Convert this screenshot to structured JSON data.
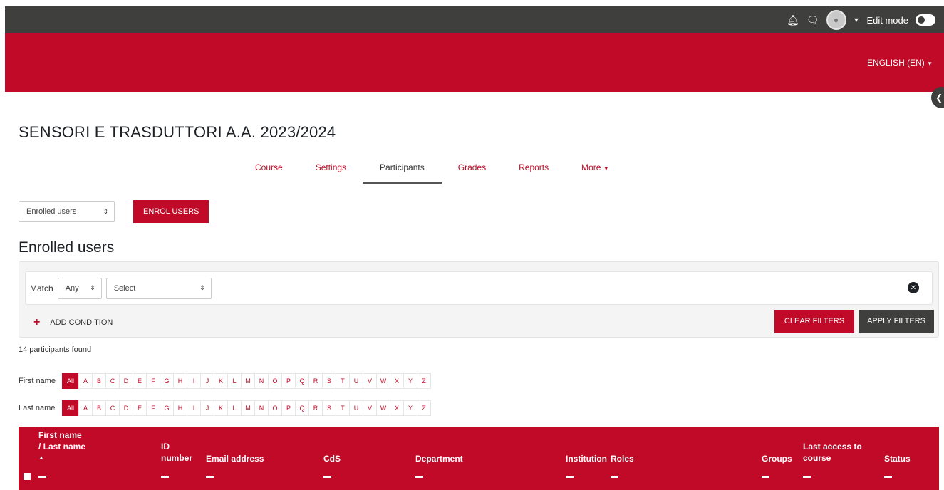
{
  "topbar": {
    "bell_icon": "bell-icon",
    "message_icon": "chat-bubble-icon",
    "edit_mode_label": "Edit mode",
    "edit_mode_on": false
  },
  "banner": {
    "language": "ENGLISH (EN)"
  },
  "course": {
    "title": "SENSORI E TRASDUTTORI A.A. 2023/2024"
  },
  "tabs": [
    {
      "label": "Course"
    },
    {
      "label": "Settings"
    },
    {
      "label": "Participants",
      "active": true
    },
    {
      "label": "Grades"
    },
    {
      "label": "Reports"
    },
    {
      "label": "More"
    }
  ],
  "enrol": {
    "selected": "Enrolled users",
    "button": "ENROL USERS"
  },
  "section": {
    "heading": "Enrolled users"
  },
  "filters": {
    "match_label": "Match",
    "match_value": "Any",
    "select_value": "Select",
    "add_condition": "ADD CONDITION",
    "clear": "CLEAR FILTERS",
    "apply": "APPLY FILTERS"
  },
  "participants_found": "14 participants found",
  "initials": {
    "first_label": "First name",
    "last_label": "Last name",
    "all": "All",
    "letters": [
      "A",
      "B",
      "C",
      "D",
      "E",
      "F",
      "G",
      "H",
      "I",
      "J",
      "K",
      "L",
      "M",
      "N",
      "O",
      "P",
      "Q",
      "R",
      "S",
      "T",
      "U",
      "V",
      "W",
      "X",
      "Y",
      "Z"
    ]
  },
  "table": {
    "columns": {
      "name_line1": "First name",
      "name_line2": "/ Last name",
      "id_line1": "ID",
      "id_line2": "number",
      "email": "Email address",
      "cds": "CdS",
      "department": "Department",
      "institution": "Institution",
      "roles": "Roles",
      "groups": "Groups",
      "last_access_line1": "Last access to",
      "last_access_line2": "course",
      "status": "Status"
    }
  },
  "colors": {
    "brand_red": "#c00a27",
    "dark": "#3f3f3d"
  }
}
